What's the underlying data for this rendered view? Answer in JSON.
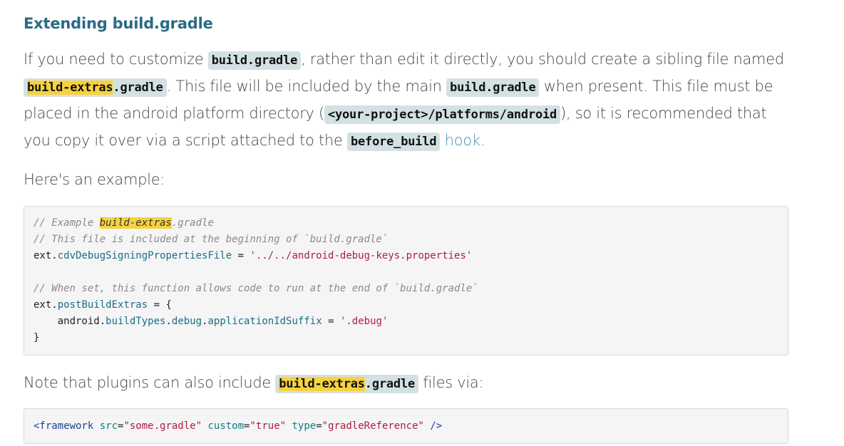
{
  "heading": "Extending build.gradle",
  "intro": {
    "t1": "If you need to customize ",
    "c1": "build.gradle",
    "t2": ", rather than edit it directly, you should create a sibling file named ",
    "c2_hl": "build-extras",
    "c2_rest": ".gradle",
    "t3": ". This file will be included by the main ",
    "c3": "build.gradle",
    "t4": " when present. This file must be placed in the android platform directory (",
    "c4": "<your-project>/platforms/android",
    "t5": "), so it is recommended that you copy it over via a script attached to the ",
    "c5": "before_build",
    "t6": " ",
    "link": "hook",
    "t7": "."
  },
  "example_text": "Here's an example:",
  "code1": {
    "l1_a": "// Example ",
    "l1_hl": "build-extras",
    "l1_b": ".gradle",
    "l2": "// This file is included at the beginning of `build.gradle`",
    "l3_obj": "ext",
    "l3_dot": ".",
    "l3_prop": "cdvDebugSigningPropertiesFile",
    "l3_eq": " = ",
    "l3_str": "'../../android-debug-keys.properties'",
    "l5": "// When set, this function allows code to run at the end of `build.gradle`",
    "l6_obj": "ext",
    "l6_dot": ".",
    "l6_prop": "postBuildExtras",
    "l6_rest": " = {",
    "l7_indent": "    android",
    "l7_d1": ".",
    "l7_p1": "buildTypes",
    "l7_d2": ".",
    "l7_p2": "debug",
    "l7_d3": ".",
    "l7_p3": "applicationIdSuffix",
    "l7_eq": " = ",
    "l7_str": "'.debug'",
    "l8": "}"
  },
  "note": {
    "t1": "Note that plugins can also include ",
    "c_hl": "build-extras",
    "c_rest": ".gradle",
    "t2": " files via:"
  },
  "code2": {
    "open": "<framework",
    "a1": " src",
    "eq1": "=",
    "v1": "\"some.gradle\"",
    "a2": " custom",
    "eq2": "=",
    "v2": "\"true\"",
    "a3": " type",
    "eq3": "=",
    "v3": "\"gradleReference\"",
    "close": " />"
  },
  "colors": {
    "heading": "#2b6a84",
    "highlight": "#f7d23e",
    "inline_code_bg": "#d3e1e3",
    "link": "#4b8fae",
    "code_bg": "#f5f5f5",
    "string": "#b01c3f"
  }
}
